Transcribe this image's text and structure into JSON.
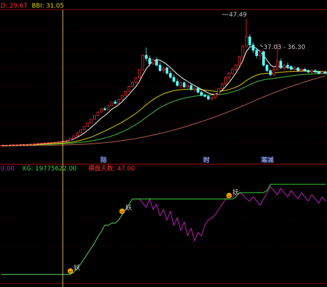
{
  "top_panel": {
    "header_left": "D: 29.67",
    "header_bbi": "BBI: 31.05",
    "peak_label": "47.49",
    "range_label": "37.03 - 36.30",
    "markers": [
      "际",
      "时",
      "筹减"
    ]
  },
  "bottom_panel": {
    "header_a": "0.00",
    "header_xg": "XG: 19775622.00",
    "header_c": "横盘天数: 47.00",
    "signal_text": "妖"
  },
  "colors": {
    "background": "#000000",
    "up": "#ff3030",
    "down": "#54fcfc",
    "ma_white": "#ffffff",
    "ma_yellow": "#e0d000",
    "ma_green": "#44c044",
    "ma_brown": "#b85c50",
    "bottom_green": "#3ad83a",
    "bottom_magenta": "#c020c0",
    "signal": "#f0a000"
  },
  "chart_data": [
    {
      "type": "candlestick",
      "title": "",
      "ylim": [
        -2,
        50
      ],
      "candles": [
        [
          0.8,
          0.9,
          0.7,
          0.85
        ],
        [
          0.85,
          0.95,
          0.8,
          0.9
        ],
        [
          0.9,
          1.0,
          0.85,
          0.95
        ],
        [
          0.95,
          1.05,
          0.9,
          1.0
        ],
        [
          1.0,
          1.1,
          0.95,
          1.05
        ],
        [
          1.05,
          1.15,
          1.0,
          1.1
        ],
        [
          1.1,
          1.2,
          1.05,
          1.15
        ],
        [
          1.15,
          1.25,
          1.1,
          1.2
        ],
        [
          1.2,
          1.3,
          1.15,
          1.25
        ],
        [
          1.25,
          1.4,
          1.2,
          1.35
        ],
        [
          1.35,
          1.5,
          1.3,
          1.45
        ],
        [
          1.45,
          1.7,
          1.4,
          1.6
        ],
        [
          1.6,
          1.8,
          1.5,
          1.7
        ],
        [
          1.7,
          1.9,
          1.6,
          1.8
        ],
        [
          1.8,
          2.0,
          1.7,
          1.9
        ],
        [
          1.9,
          2.1,
          1.8,
          2.0
        ],
        [
          2.0,
          2.2,
          1.9,
          2.1
        ],
        [
          2.1,
          2.4,
          2.0,
          2.3
        ],
        [
          2.3,
          2.6,
          2.2,
          2.5
        ],
        [
          2.5,
          2.8,
          2.4,
          2.7
        ],
        [
          2.7,
          3.5,
          2.6,
          3.4
        ],
        [
          3.4,
          4.5,
          3.3,
          4.4
        ],
        [
          4.4,
          5.6,
          4.3,
          5.5
        ],
        [
          5.5,
          6.8,
          5.4,
          6.7
        ],
        [
          6.7,
          8.0,
          6.5,
          7.9
        ],
        [
          7.9,
          9.3,
          7.8,
          9.2
        ],
        [
          9.2,
          10.6,
          9.0,
          10.5
        ],
        [
          10.5,
          12.0,
          10.3,
          11.9
        ],
        [
          11.9,
          13.3,
          11.7,
          13.2
        ],
        [
          13.2,
          14.5,
          13.0,
          14.4
        ],
        [
          14.4,
          15.2,
          13.8,
          14.0
        ],
        [
          14.0,
          15.6,
          13.8,
          15.5
        ],
        [
          15.5,
          17.0,
          15.4,
          16.9
        ],
        [
          16.9,
          17.8,
          16.0,
          16.4
        ],
        [
          16.4,
          18.0,
          16.2,
          17.8
        ],
        [
          17.8,
          19.5,
          17.6,
          19.4
        ],
        [
          19.4,
          21.0,
          19.0,
          20.8
        ],
        [
          20.8,
          22.8,
          20.6,
          22.6
        ],
        [
          22.6,
          24.4,
          22.4,
          24.2
        ],
        [
          24.2,
          26.0,
          23.5,
          25.8
        ],
        [
          25.8,
          29.0,
          25.6,
          28.8
        ],
        [
          28.8,
          34.5,
          28.5,
          34.2
        ],
        [
          34.2,
          37.0,
          32.0,
          33.0
        ],
        [
          33.0,
          34.0,
          30.0,
          31.0
        ],
        [
          31.0,
          33.0,
          30.5,
          32.5
        ],
        [
          32.5,
          33.5,
          30.0,
          30.5
        ],
        [
          30.5,
          31.5,
          28.0,
          28.5
        ],
        [
          28.5,
          30.0,
          27.5,
          29.5
        ],
        [
          29.5,
          30.0,
          27.0,
          27.5
        ],
        [
          27.5,
          28.5,
          25.5,
          26.0
        ],
        [
          26.0,
          27.0,
          24.0,
          24.5
        ],
        [
          24.5,
          25.5,
          22.5,
          23.0
        ],
        [
          23.0,
          24.5,
          22.0,
          24.0
        ],
        [
          24.0,
          24.5,
          22.0,
          22.5
        ],
        [
          22.5,
          23.5,
          21.5,
          23.0
        ],
        [
          23.0,
          23.5,
          21.0,
          21.5
        ],
        [
          21.5,
          22.5,
          20.5,
          22.0
        ],
        [
          22.0,
          22.5,
          20.0,
          20.5
        ],
        [
          20.5,
          21.0,
          19.0,
          19.5
        ],
        [
          19.5,
          20.0,
          18.5,
          19.0
        ],
        [
          19.0,
          19.5,
          17.5,
          18.0
        ],
        [
          18.0,
          19.0,
          17.5,
          18.5
        ],
        [
          18.5,
          20.0,
          18.0,
          19.8
        ],
        [
          19.8,
          22.0,
          19.5,
          21.8
        ],
        [
          21.8,
          24.0,
          21.5,
          23.5
        ],
        [
          23.5,
          26.5,
          23.0,
          26.0
        ],
        [
          26.0,
          28.0,
          25.0,
          27.5
        ],
        [
          27.5,
          29.5,
          27.0,
          29.0
        ],
        [
          29.0,
          31.0,
          28.0,
          30.5
        ],
        [
          30.5,
          34.0,
          30.0,
          33.5
        ],
        [
          33.5,
          38.0,
          33.0,
          37.5
        ],
        [
          37.5,
          47.5,
          37.0,
          41.0
        ],
        [
          41.0,
          42.0,
          37.0,
          38.0
        ],
        [
          38.0,
          39.0,
          35.0,
          36.0
        ],
        [
          36.0,
          37.0,
          33.0,
          34.0
        ],
        [
          34.0,
          36.0,
          32.5,
          35.5
        ],
        [
          35.5,
          36.0,
          30.0,
          30.5
        ],
        [
          30.5,
          31.0,
          28.0,
          28.5
        ],
        [
          28.5,
          29.0,
          26.5,
          27.0
        ],
        [
          27.0,
          29.5,
          26.5,
          29.0
        ],
        [
          29.0,
          38.5,
          28.5,
          32.0
        ],
        [
          32.0,
          33.0,
          29.0,
          29.5
        ],
        [
          29.5,
          31.0,
          28.5,
          30.5
        ],
        [
          30.5,
          31.5,
          29.0,
          30.0
        ],
        [
          30.0,
          30.5,
          28.5,
          29.0
        ],
        [
          29.0,
          30.0,
          28.0,
          29.5
        ],
        [
          29.5,
          30.0,
          28.0,
          28.5
        ],
        [
          28.5,
          29.5,
          28.0,
          29.0
        ],
        [
          29.0,
          29.5,
          28.0,
          28.5
        ],
        [
          28.5,
          29.0,
          27.5,
          28.0
        ],
        [
          28.0,
          29.0,
          27.5,
          28.5
        ],
        [
          28.5,
          29.0,
          27.5,
          28.0
        ],
        [
          28.0,
          28.5,
          27.0,
          27.5
        ],
        [
          27.5,
          28.5,
          27.0,
          28.0
        ],
        [
          28.0,
          28.5,
          27.0,
          27.5
        ]
      ],
      "ma_white": [
        0.85,
        0.88,
        0.92,
        0.97,
        1.02,
        1.07,
        1.12,
        1.17,
        1.22,
        1.28,
        1.36,
        1.48,
        1.58,
        1.68,
        1.78,
        1.88,
        1.98,
        2.1,
        2.25,
        2.4,
        2.75,
        3.25,
        3.9,
        4.6,
        5.45,
        6.4,
        7.45,
        8.6,
        9.8,
        11.0,
        11.9,
        13.0,
        14.2,
        15.0,
        15.9,
        17.0,
        18.3,
        19.7,
        21.2,
        22.6,
        24.4,
        27.0,
        29.2,
        30.8,
        32.0,
        32.6,
        32.3,
        31.6,
        30.7,
        29.6,
        28.4,
        27.2,
        26.2,
        25.3,
        24.5,
        23.7,
        23.0,
        22.3,
        21.6,
        20.9,
        20.2,
        19.8,
        19.8,
        20.3,
        21.2,
        22.6,
        24.1,
        25.8,
        27.6,
        29.7,
        32.2,
        35.5,
        37.2,
        37.4,
        36.6,
        35.6,
        34.1,
        32.4,
        30.6,
        29.8,
        30.3,
        29.9,
        29.9,
        29.7,
        29.4,
        29.2,
        28.9,
        28.8,
        28.6,
        28.4,
        28.3,
        28.1,
        27.9,
        27.8,
        27.6
      ],
      "ma_yellow": [
        0.8,
        0.82,
        0.85,
        0.88,
        0.92,
        0.96,
        1.0,
        1.04,
        1.08,
        1.12,
        1.17,
        1.23,
        1.3,
        1.37,
        1.44,
        1.52,
        1.6,
        1.68,
        1.78,
        1.88,
        2.0,
        2.2,
        2.45,
        2.75,
        3.1,
        3.5,
        3.95,
        4.45,
        5.0,
        5.6,
        6.2,
        6.8,
        7.45,
        8.1,
        8.75,
        9.45,
        10.2,
        11.0,
        11.85,
        12.75,
        13.7,
        14.8,
        15.9,
        16.9,
        17.8,
        18.6,
        19.3,
        19.9,
        20.4,
        20.8,
        21.1,
        21.3,
        21.45,
        21.55,
        21.6,
        21.6,
        21.55,
        21.5,
        21.4,
        21.3,
        21.15,
        21.0,
        20.9,
        20.9,
        21.0,
        21.2,
        21.5,
        21.9,
        22.4,
        23.0,
        23.8,
        24.8,
        25.6,
        26.3,
        26.8,
        27.2,
        27.4,
        27.5,
        27.5,
        27.6,
        27.8,
        27.9,
        28.0,
        28.1,
        28.15,
        28.2,
        28.25,
        28.3,
        28.3,
        28.3,
        28.3,
        28.25,
        28.2,
        28.15,
        28.1
      ],
      "ma_green": [
        0.8,
        0.81,
        0.83,
        0.85,
        0.88,
        0.91,
        0.94,
        0.97,
        1.0,
        1.03,
        1.07,
        1.11,
        1.16,
        1.21,
        1.26,
        1.32,
        1.38,
        1.44,
        1.5,
        1.57,
        1.65,
        1.75,
        1.87,
        2.0,
        2.15,
        2.32,
        2.52,
        2.75,
        3.0,
        3.3,
        3.6,
        3.95,
        4.35,
        4.8,
        5.3,
        5.85,
        6.45,
        7.1,
        7.8,
        8.55,
        9.4,
        10.3,
        11.25,
        12.2,
        13.1,
        14.0,
        14.8,
        15.5,
        16.1,
        16.7,
        17.2,
        17.6,
        18.0,
        18.3,
        18.6,
        18.85,
        19.05,
        19.2,
        19.3,
        19.4,
        19.45,
        19.5,
        19.55,
        19.65,
        19.8,
        20.0,
        20.3,
        20.65,
        21.05,
        21.5,
        22.05,
        22.7,
        23.3,
        23.9,
        24.4,
        24.8,
        25.1,
        25.3,
        25.45,
        25.6,
        25.8,
        26.0,
        26.2,
        26.4,
        26.55,
        26.7,
        26.85,
        27.0,
        27.1,
        27.2,
        27.3,
        27.35,
        27.4,
        27.45,
        27.5
      ],
      "ma_brown": [
        0.6,
        0.62,
        0.64,
        0.66,
        0.68,
        0.7,
        0.72,
        0.74,
        0.76,
        0.78,
        0.8,
        0.82,
        0.85,
        0.88,
        0.91,
        0.94,
        0.97,
        1.0,
        1.03,
        1.06,
        1.1,
        1.15,
        1.2,
        1.26,
        1.32,
        1.39,
        1.47,
        1.56,
        1.66,
        1.77,
        1.89,
        2.02,
        2.16,
        2.31,
        2.47,
        2.64,
        2.82,
        3.01,
        3.21,
        3.42,
        3.64,
        3.88,
        4.14,
        4.41,
        4.69,
        4.98,
        5.28,
        5.59,
        5.91,
        6.24,
        6.58,
        6.93,
        7.29,
        7.66,
        8.04,
        8.43,
        8.83,
        9.24,
        9.66,
        10.09,
        10.53,
        10.98,
        11.44,
        11.91,
        12.39,
        12.88,
        13.38,
        13.89,
        14.41,
        14.94,
        15.48,
        16.03,
        16.59,
        17.15,
        17.7,
        18.24,
        18.77,
        19.29,
        19.8,
        20.3,
        20.79,
        21.27,
        21.74,
        22.2,
        22.65,
        23.09,
        23.52,
        23.94,
        24.35,
        24.75,
        25.14,
        25.52,
        25.89,
        26.25,
        26.6
      ]
    },
    {
      "type": "line",
      "title": "",
      "ylim": [
        0,
        100
      ],
      "series": [
        {
          "values": [
            8,
            8,
            8,
            8,
            8,
            8,
            8,
            8,
            8,
            8,
            8,
            8,
            8,
            8,
            8,
            8,
            8,
            8,
            8,
            8,
            8,
            10,
            14,
            18,
            23,
            28,
            33,
            38,
            44,
            49,
            55,
            55,
            57,
            57,
            60,
            65,
            70,
            75,
            80,
            80,
            80,
            80,
            80,
            80,
            80,
            80,
            80,
            80,
            80,
            80,
            80,
            80,
            80,
            80,
            80,
            80,
            80,
            80,
            80,
            80,
            80,
            80,
            80,
            80,
            80,
            80,
            80,
            80,
            82,
            86,
            86,
            86,
            86,
            86,
            86,
            86,
            86,
            88,
            94,
            94,
            94,
            94,
            94,
            94,
            94,
            94,
            94,
            94,
            94,
            94,
            94,
            94,
            94,
            94,
            94
          ]
        },
        {
          "values": [
            8,
            8,
            8,
            8,
            8,
            8,
            8,
            8,
            8,
            8,
            8,
            8,
            8,
            8,
            8,
            8,
            8,
            8,
            8,
            8,
            8,
            10,
            14,
            18,
            23,
            28,
            33,
            38,
            44,
            49,
            55,
            55,
            57,
            57,
            60,
            65,
            70,
            75,
            80,
            80,
            80,
            76,
            72,
            80,
            70,
            75,
            64,
            70,
            60,
            68,
            55,
            62,
            50,
            58,
            45,
            52,
            40,
            48,
            45,
            55,
            60,
            62,
            65,
            70,
            75,
            80,
            82,
            82,
            84,
            86,
            84,
            80,
            78,
            82,
            78,
            74,
            80,
            86,
            92,
            88,
            84,
            90,
            86,
            82,
            88,
            84,
            80,
            86,
            82,
            78,
            84,
            80,
            76,
            82,
            78
          ]
        }
      ]
    }
  ]
}
